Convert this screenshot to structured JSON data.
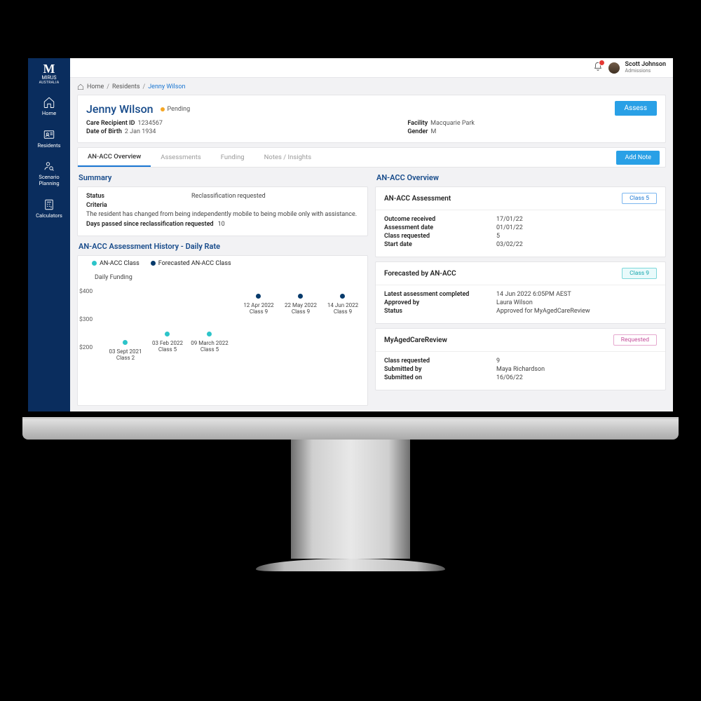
{
  "brand": {
    "name": "MIRUS",
    "sub": "AUSTRALIA"
  },
  "sidebar": {
    "items": [
      {
        "label": "Home"
      },
      {
        "label": "Residents"
      },
      {
        "label": "Scenario\nPlanning"
      },
      {
        "label": "Calculators"
      }
    ]
  },
  "topbar": {
    "user_name": "Scott Johnson",
    "user_role": "Admissions"
  },
  "breadcrumb": {
    "home": "Home",
    "section": "Residents",
    "active": "Jenny Wilson"
  },
  "header": {
    "name": "Jenny Wilson",
    "status_label": "Pending",
    "assess_btn": "Assess",
    "left": [
      {
        "k": "Care Recipient ID",
        "v": "1234567"
      },
      {
        "k": "Date of Birth",
        "v": "2 Jan 1934"
      }
    ],
    "right": [
      {
        "k": "Facility",
        "v": "Macquarie Park"
      },
      {
        "k": "Gender",
        "v": "M"
      }
    ]
  },
  "tabs": {
    "items": [
      "AN-ACC Overview",
      "Assessments",
      "Funding",
      "Notes / Insights"
    ],
    "add_note": "Add Note"
  },
  "summary": {
    "title": "Summary",
    "status_k": "Status",
    "status_v": "Reclassification requested",
    "criteria_k": "Criteria",
    "criteria_text": "The resident has changed from being independently mobile to being mobile only with assistance.",
    "days_k": "Days passed since reclassification requested",
    "days_v": "10"
  },
  "chart": {
    "title": "AN-ACC Assessment History - Daily Rate",
    "legend_a": "AN-ACC Class",
    "legend_b": "Forecasted AN-ACC Class",
    "axis_label": "Daily Funding",
    "yticks": {
      "t400": "$400",
      "t300": "$300",
      "t200": "$200"
    }
  },
  "chart_data": {
    "type": "scatter",
    "ylabel": "Daily Funding",
    "ylim": [
      200,
      400
    ],
    "series": [
      {
        "name": "AN-ACC Class",
        "color": "#2cc4c9",
        "points": [
          {
            "x": "03 Sept 2021",
            "y": 220,
            "label_line1": "03 Sept 2021",
            "label_line2": "Class 2"
          },
          {
            "x": "03 Feb 2022",
            "y": 250,
            "label_line1": "03 Feb 2022",
            "label_line2": "Class 5"
          },
          {
            "x": "09 March 2022",
            "y": 250,
            "label_line1": "09 March 2022",
            "label_line2": "Class 5"
          }
        ]
      },
      {
        "name": "Forecasted AN-ACC Class",
        "color": "#063a6b",
        "points": [
          {
            "x": "12 Apr 2022",
            "y": 370,
            "label_line1": "12 Apr 2022",
            "label_line2": "Class 9"
          },
          {
            "x": "22 May 2022",
            "y": 370,
            "label_line1": "22 May 2022",
            "label_line2": "Class 9"
          },
          {
            "x": "14 Jun 2022",
            "y": 370,
            "label_line1": "14 Jun 2022",
            "label_line2": "Class 9"
          }
        ]
      }
    ]
  },
  "overview": {
    "title": "AN-ACC Overview",
    "assessment": {
      "heading": "AN-ACC Assessment",
      "badge": "Class 5",
      "rows": [
        {
          "k": "Outcome received",
          "v": "17/01/22"
        },
        {
          "k": "Assessment date",
          "v": "01/01/22"
        },
        {
          "k": "Class requested",
          "v": "5"
        },
        {
          "k": "Start date",
          "v": "03/02/22"
        }
      ]
    },
    "forecast": {
      "heading": "Forecasted by AN-ACC",
      "badge": "Class 9",
      "rows": [
        {
          "k": "Latest assessment completed",
          "v": "14 Jun 2022 6:05PM AEST"
        },
        {
          "k": "Approved by",
          "v": "Laura Wilson"
        },
        {
          "k": "Status",
          "v": "Approved for MyAgedCareReview"
        }
      ]
    },
    "review": {
      "heading": "MyAgedCareReview",
      "badge": "Requested",
      "rows": [
        {
          "k": "Class requested",
          "v": "9"
        },
        {
          "k": "Submitted by",
          "v": "Maya Richardson"
        },
        {
          "k": "Submitted on",
          "v": "16/06/22"
        }
      ]
    }
  }
}
